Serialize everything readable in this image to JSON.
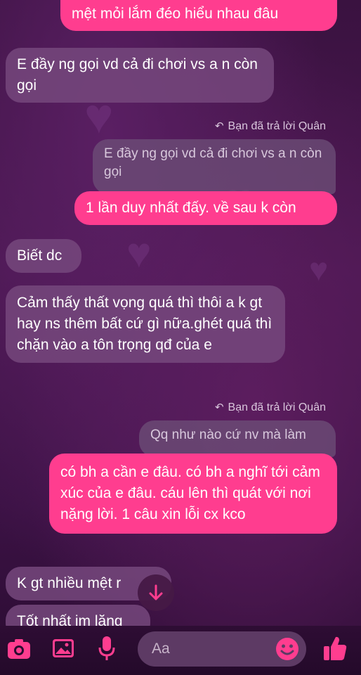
{
  "messages": {
    "m1_text": "mệt mỏi lắm đéo hiểu nhau đâu",
    "m2_text": "E đầy ng gọi vd cả đi chơi vs a n còn gọi",
    "reply1_note": "Bạn đã trả lời Quân",
    "reply1_quote": "E đầy ng gọi vd cả đi chơi vs a n còn gọi",
    "m3_text": "1 lần duy nhất đấy. về sau k còn",
    "m4_text": "Biết dc",
    "m5_text": "Cảm thấy thất vọng quá thì thôi a k gt hay ns thêm bất cứ gì nữa.ghét quá thì chặn vào a tôn trọng qđ của e",
    "reply2_note": "Bạn đã trả lời Quân",
    "reply2_quote": "Qq như nào cứ nv mà làm",
    "m6_text": "có bh a cần e đâu. có bh a nghĩ tới cảm xúc của e đâu. cáu lên thì quát với nơi nặng lời. 1 câu xin lỗi cx kco",
    "m7_text": "K gt nhiều mệt r",
    "m8_text": "Tốt nhất im lặng"
  },
  "composer": {
    "placeholder": "Aa",
    "icons": [
      "camera-icon",
      "image-icon",
      "microphone-icon",
      "emoji-icon",
      "thumbs-up-icon"
    ]
  },
  "colors": {
    "accent": "#ff3d8f",
    "incoming_bubble": "#76487c",
    "background": "#3a1240"
  }
}
